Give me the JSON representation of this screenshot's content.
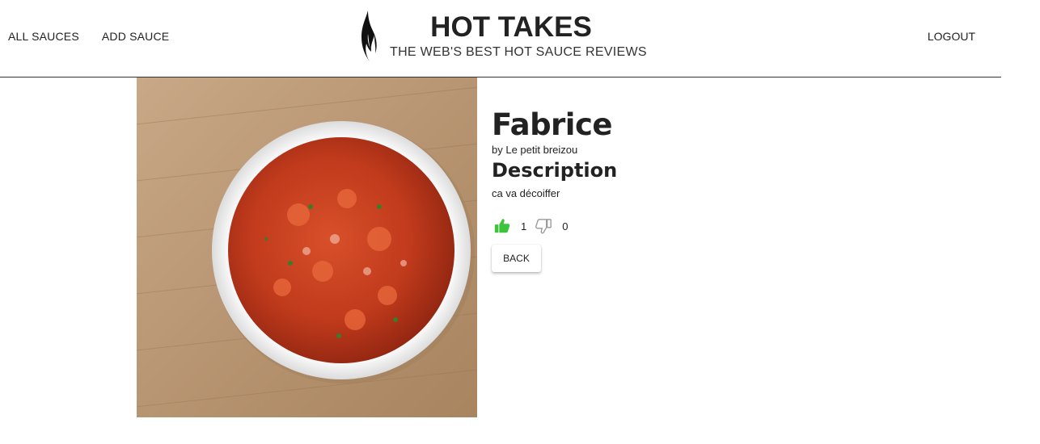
{
  "nav": {
    "all_sauces": "ALL SAUCES",
    "add_sauce": "ADD SAUCE",
    "logout": "LOGOUT"
  },
  "brand": {
    "title": "HOT TAKES",
    "subtitle": "THE WEB'S BEST HOT SAUCE REVIEWS",
    "logo_icon": "flame-icon"
  },
  "sauce": {
    "name": "Fabrice",
    "manufacturer_line": "by Le petit breizou",
    "description_heading": "Description",
    "description": "ca va décoiffer",
    "image": "salsa-bowl-photo",
    "likes": "1",
    "dislikes": "0",
    "like_icon": "thumbs-up-icon",
    "dislike_icon": "thumbs-down-icon"
  },
  "actions": {
    "back_label": "BACK"
  },
  "colors": {
    "like_active": "#3cc43c",
    "dislike_inactive": "#9a9a9a",
    "header_border": "#333333",
    "text": "#222222"
  }
}
